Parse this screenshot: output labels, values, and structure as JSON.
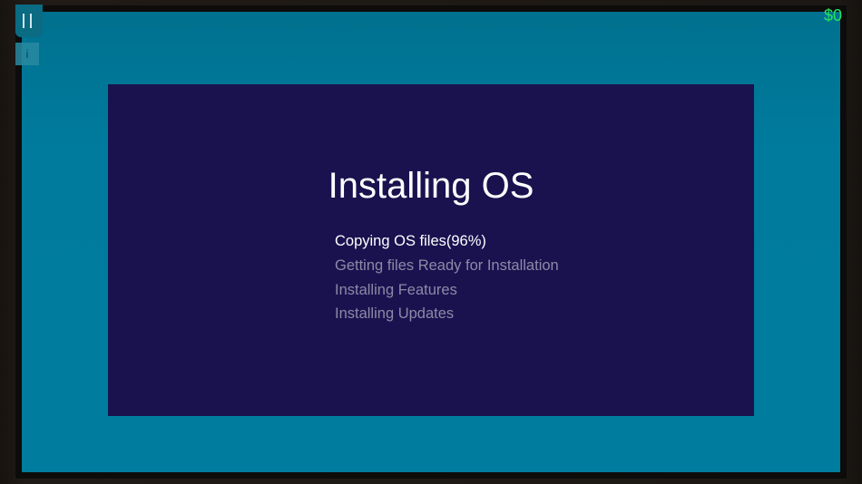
{
  "hud": {
    "money": "$0",
    "info_label": "i"
  },
  "installer": {
    "title": "Installing OS",
    "steps": [
      {
        "label": "Copying OS files(96%)",
        "state": "active",
        "progress_percent": 96
      },
      {
        "label": "Getting files Ready for Installation",
        "state": "pending"
      },
      {
        "label": "Installing Features",
        "state": "pending"
      },
      {
        "label": "Installing Updates",
        "state": "pending"
      }
    ]
  },
  "colors": {
    "screen_background": "#007b9d",
    "panel_background": "#1a124f",
    "active_step_text": "#ffffff",
    "pending_step_text": "#8c8aa6",
    "money_text": "#27e35f"
  }
}
